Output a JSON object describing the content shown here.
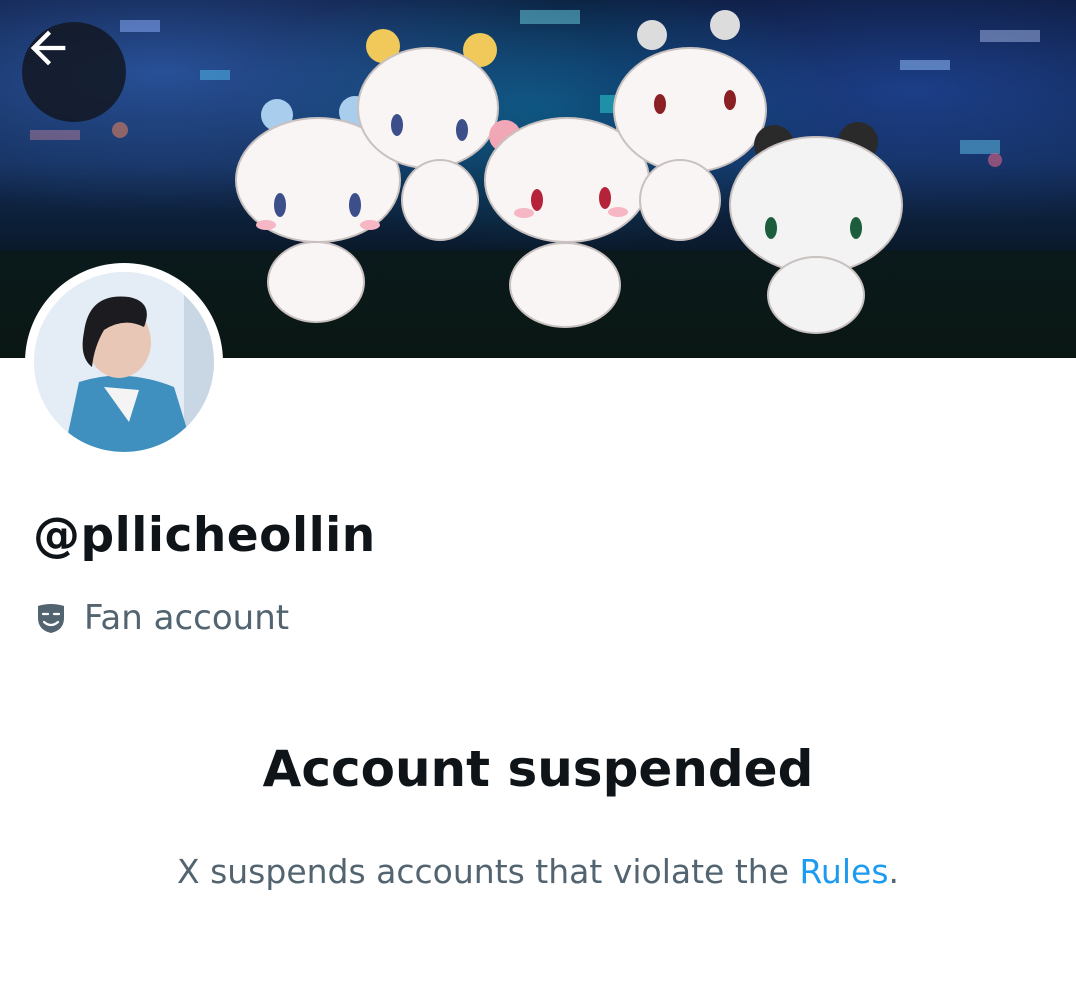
{
  "header": {
    "back_icon": "arrow-left-icon"
  },
  "profile": {
    "handle": "@pllicheollin",
    "category_icon": "theater-masks-icon",
    "category_label": "Fan account"
  },
  "suspension": {
    "title": "Account suspended",
    "description_prefix": "X suspends accounts that violate the ",
    "rules_link": "Rules",
    "description_suffix": "."
  },
  "colors": {
    "text_primary": "#0f1419",
    "text_secondary": "#536471",
    "link": "#1d9bf0"
  }
}
